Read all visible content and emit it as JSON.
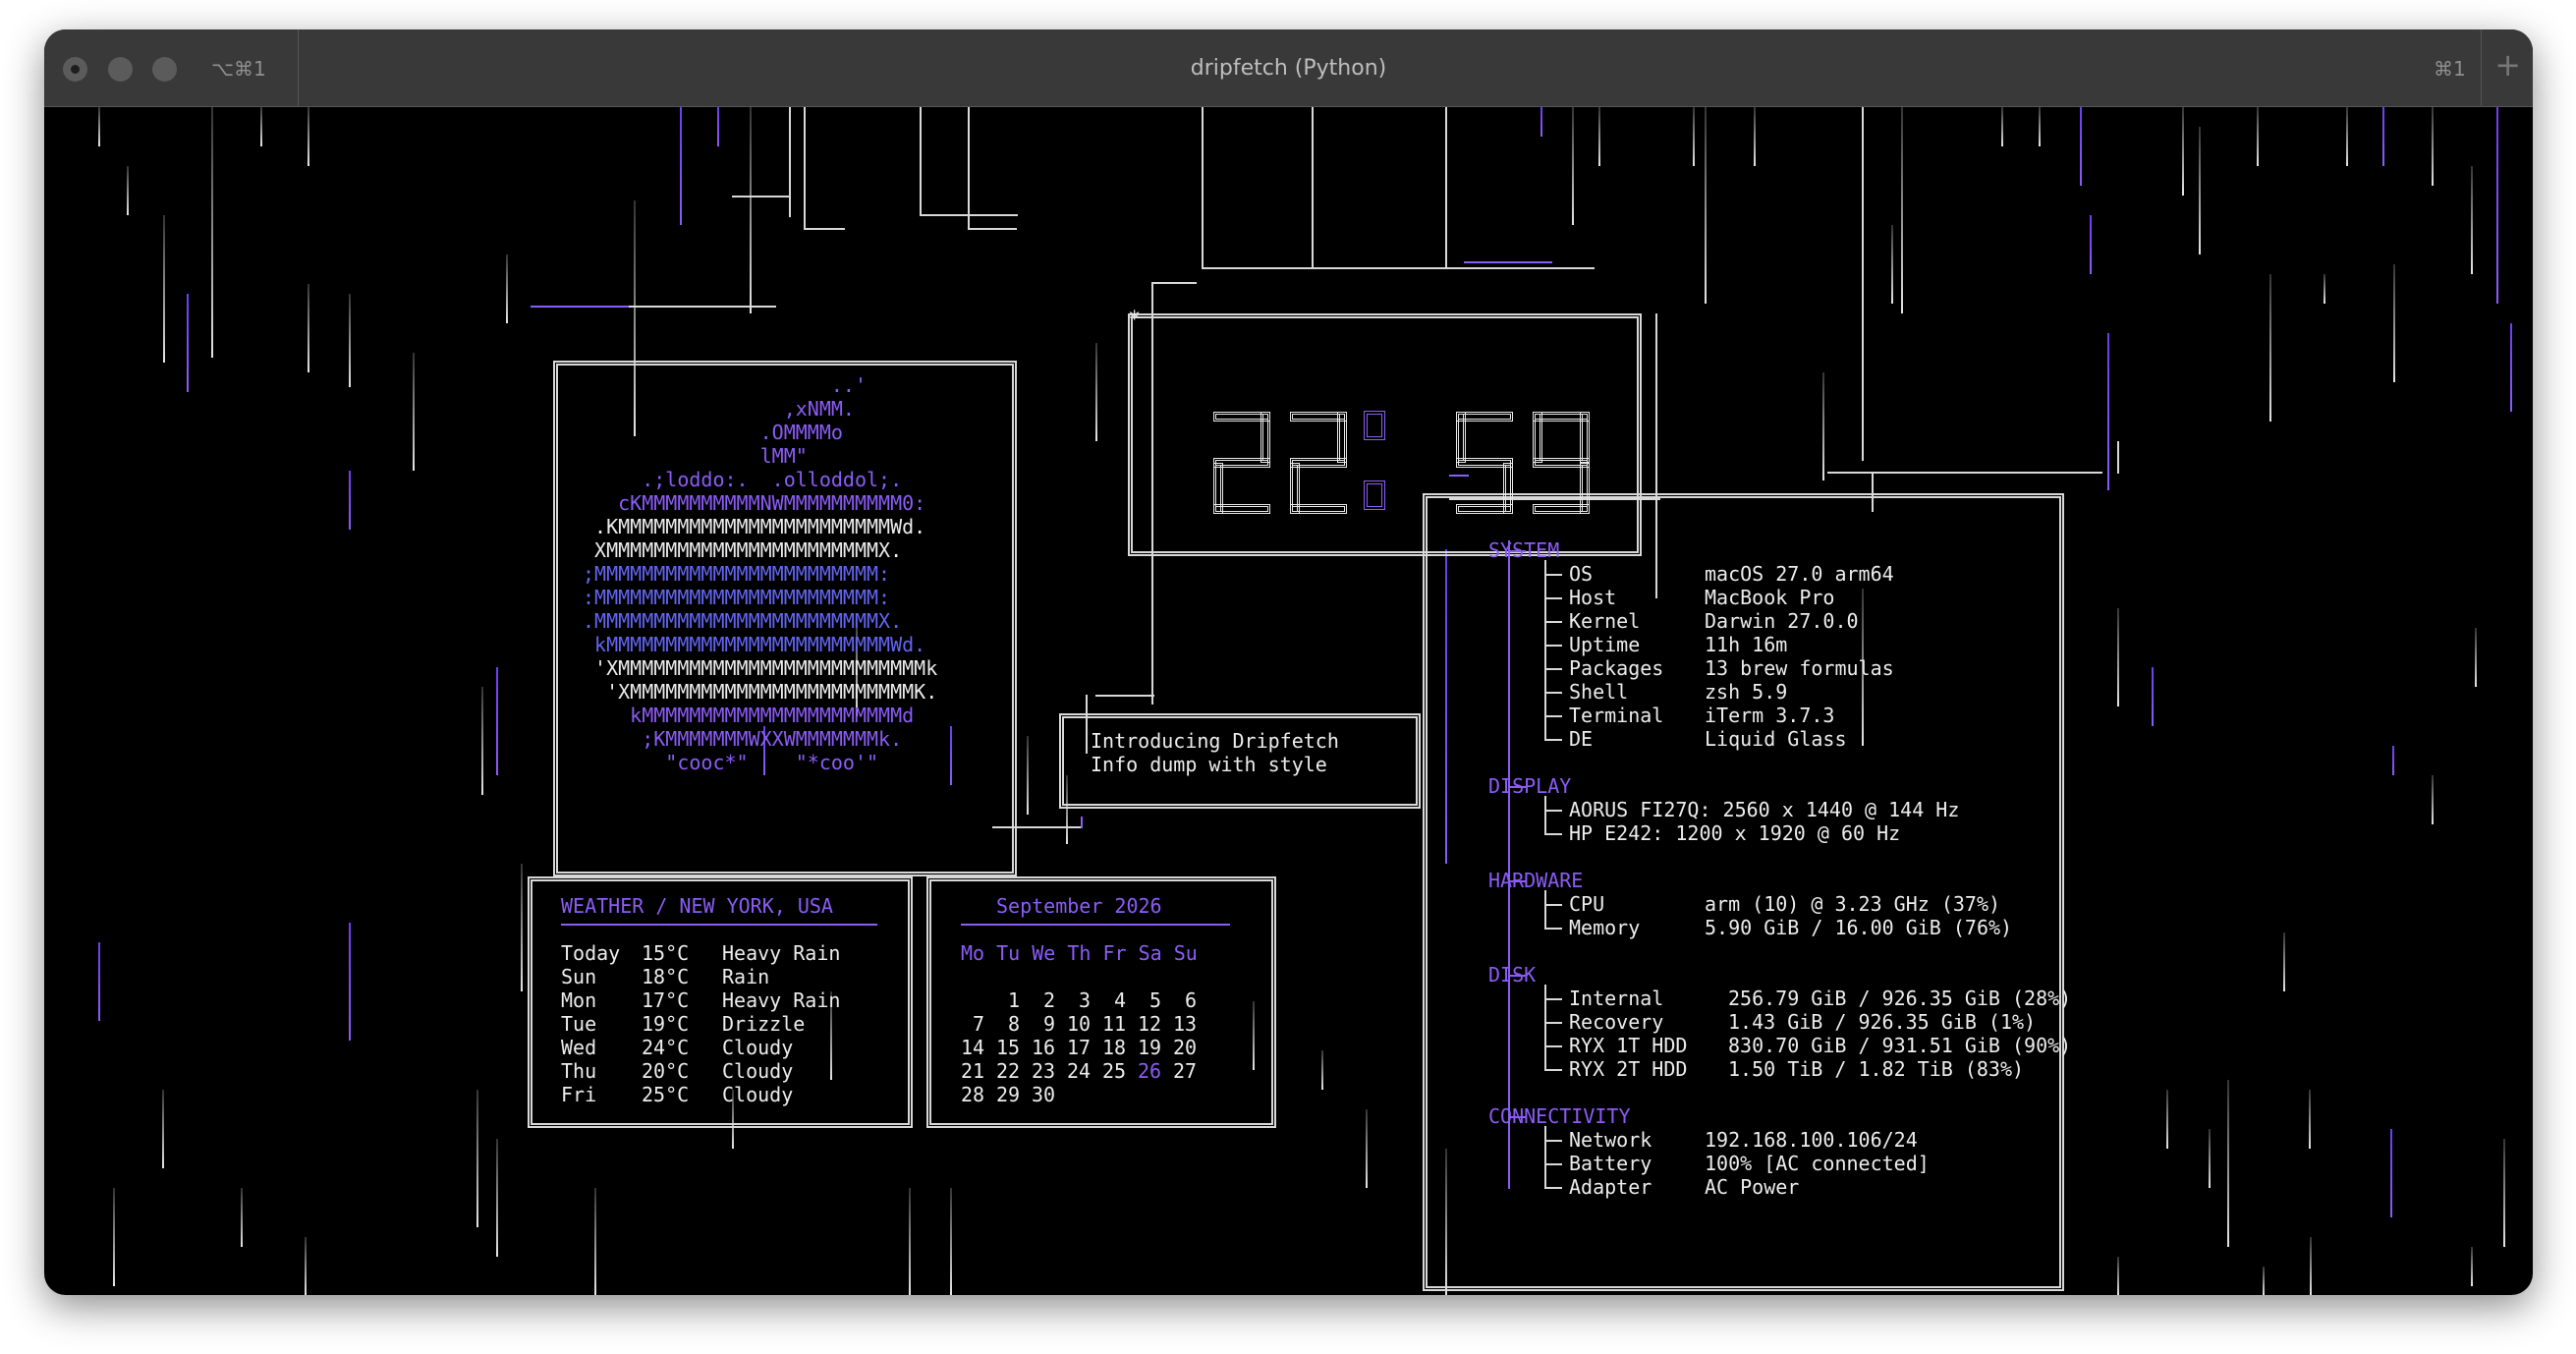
{
  "window": {
    "title": "dripfetch (Python)",
    "tab_shortcut": "⌥⌘1",
    "right_shortcut": "⌘1",
    "new_tab": "+"
  },
  "logo_art": [
    {
      "t": "                     ..'",
      "c": "p"
    },
    {
      "t": "                 ,xNMM.",
      "c": "p"
    },
    {
      "t": "               .OMMMMo",
      "c": "p"
    },
    {
      "t": "               lMM\"",
      "c": "p"
    },
    {
      "t": "     .;loddo:.  .olloddol;.",
      "c": "p"
    },
    {
      "t": "   cKMMMMMMMMMMNWMMMMMMMMMM0:",
      "c": "p"
    },
    {
      "t": " .KMMMMMMMMMMMMMMMMMMMMMMMWd.",
      "c": "w"
    },
    {
      "t": " XMMMMMMMMMMMMMMMMMMMMMMMX.",
      "c": "w"
    },
    {
      "t": ";MMMMMMMMMMMMMMMMMMMMMMMM:",
      "c": "p2"
    },
    {
      "t": ":MMMMMMMMMMMMMMMMMMMMMMMM:",
      "c": "p2"
    },
    {
      "t": ".MMMMMMMMMMMMMMMMMMMMMMMMX.",
      "c": "p2"
    },
    {
      "t": " kMMMMMMMMMMMMMMMMMMMMMMMMWd.",
      "c": "p2"
    },
    {
      "t": " 'XMMMMMMMMMMMMMMMMMMMMMMMMMMk",
      "c": "w"
    },
    {
      "t": "  'XMMMMMMMMMMMMMMMMMMMMMMMMK.",
      "c": "w"
    },
    {
      "t": "    kMMMMMMMMMMMMMMMMMMMMMMd",
      "c": "p"
    },
    {
      "t": "     ;KMMMMMMMWXXWMMMMMMMk.",
      "c": "p"
    },
    {
      "t": "       \"cooc*\"    \"*coo'\"",
      "c": "p"
    }
  ],
  "clock": {
    "hours": "22",
    "minutes": "59",
    "corner_mark": "*"
  },
  "intro": {
    "line1": "Introducing Dripfetch",
    "line2": "Info dump with style"
  },
  "weather": {
    "title": "WEATHER / NEW YORK, USA",
    "rows": [
      {
        "day": "Today",
        "temp": "15°C",
        "cond": "Heavy Rain"
      },
      {
        "day": "Sun",
        "temp": "18°C",
        "cond": "Rain"
      },
      {
        "day": "Mon",
        "temp": "17°C",
        "cond": "Heavy Rain"
      },
      {
        "day": "Tue",
        "temp": "19°C",
        "cond": "Drizzle"
      },
      {
        "day": "Wed",
        "temp": "24°C",
        "cond": "Cloudy"
      },
      {
        "day": "Thu",
        "temp": "20°C",
        "cond": "Cloudy"
      },
      {
        "day": "Fri",
        "temp": "25°C",
        "cond": "Cloudy"
      }
    ]
  },
  "calendar": {
    "title": "September 2026",
    "weekdays": "Mo Tu We Th Fr Sa Su",
    "weeks": [
      [
        "",
        "1",
        "2",
        "3",
        "4",
        "5",
        "6"
      ],
      [
        "7",
        "8",
        "9",
        "10",
        "11",
        "12",
        "13"
      ],
      [
        "14",
        "15",
        "16",
        "17",
        "18",
        "19",
        "20"
      ],
      [
        "21",
        "22",
        "23",
        "24",
        "25",
        "26",
        "27"
      ],
      [
        "28",
        "29",
        "30",
        "",
        "",
        "",
        ""
      ]
    ],
    "today": "26"
  },
  "sysinfo": {
    "sections": [
      {
        "name": "SYSTEM",
        "items": [
          {
            "k": "OS",
            "v": "macOS 27.0 arm64"
          },
          {
            "k": "Host",
            "v": "MacBook Pro"
          },
          {
            "k": "Kernel",
            "v": "Darwin 27.0.0"
          },
          {
            "k": "Uptime",
            "v": "11h 16m"
          },
          {
            "k": "Packages",
            "v": "13 brew formulas"
          },
          {
            "k": "Shell",
            "v": "zsh 5.9"
          },
          {
            "k": "Terminal",
            "v": "iTerm 3.7.3"
          },
          {
            "k": "DE",
            "v": "Liquid Glass"
          }
        ]
      },
      {
        "name": "DISPLAY",
        "items": [
          {
            "k": "AORUS FI27Q: 2560 x 1440 @ 144 Hz",
            "v": ""
          },
          {
            "k": "HP E242: 1200 x 1920 @ 60 Hz",
            "v": ""
          }
        ]
      },
      {
        "name": "HARDWARE",
        "items": [
          {
            "k": "CPU",
            "v": "arm (10) @ 3.23 GHz (37%)"
          },
          {
            "k": "Memory",
            "v": "5.90 GiB / 16.00 GiB (76%)"
          }
        ]
      },
      {
        "name": "DISK",
        "items": [
          {
            "k": "Internal",
            "v": "256.79 GiB / 926.35 GiB (28%)"
          },
          {
            "k": "Recovery",
            "v": "1.43 GiB / 926.35 GiB (1%)"
          },
          {
            "k": "RYX 1T HDD",
            "v": "830.70 GiB / 931.51 GiB (90%)"
          },
          {
            "k": "RYX 2T HDD",
            "v": "1.50 TiB / 1.82 TiB (83%)"
          }
        ]
      },
      {
        "name": "CONNECTIVITY",
        "items": [
          {
            "k": "Network",
            "v": "192.168.100.106/24"
          },
          {
            "k": "Battery",
            "v": "100% [AC connected]"
          },
          {
            "k": "Adapter",
            "v": "AC Power"
          }
        ]
      }
    ]
  },
  "colors": {
    "accent": "#8b5cf6",
    "foreground": "#ececec",
    "background": "#000000"
  }
}
